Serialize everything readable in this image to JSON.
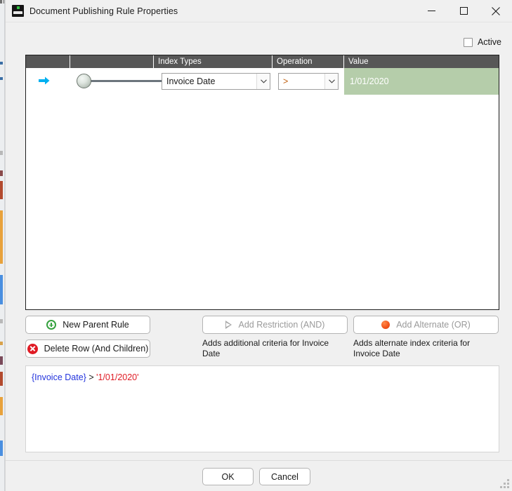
{
  "window": {
    "title": "Document Publishing Rule Properties",
    "app_icon": "document-publishing-icon",
    "minimize_icon": "minimize-icon",
    "maximize_icon": "maximize-icon",
    "close_icon": "close-icon"
  },
  "options": {
    "active_label": "Active",
    "active_checked": false
  },
  "grid": {
    "columns": [
      "",
      "",
      "Index Types",
      "Operation",
      "Value"
    ],
    "rows": [
      {
        "row_indicator": "current-row-arrow",
        "index_type": "Invoice Date",
        "operation": ">",
        "value": "1/01/2020",
        "value_cell_color": "#b5cdaa"
      }
    ]
  },
  "actions": {
    "new_parent_rule": "New Parent Rule",
    "delete_row": "Delete Row (And Children)",
    "add_restriction": "Add Restriction (AND)",
    "add_alternate": "Add Alternate (OR)",
    "hint_restriction": "Adds additional criteria for Invoice Date",
    "hint_alternate": "Adds alternate index criteria for Invoice Date"
  },
  "preview": {
    "field": "{Invoice Date}",
    "operator": ">",
    "literal": "'1/01/2020'"
  },
  "footer": {
    "ok": "OK",
    "cancel": "Cancel"
  },
  "colors": {
    "header_bar": "#575757",
    "value_highlight": "#b5cdaa",
    "arrow_accent": "#00b0f0",
    "field_token": "#2233dd",
    "literal_token": "#e01b24",
    "operator_text": "#c06010"
  }
}
